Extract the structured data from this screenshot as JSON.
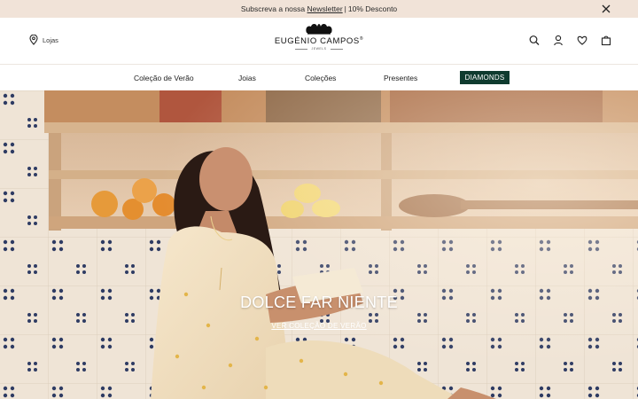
{
  "announcement": {
    "prefix": "Subscreva a nossa",
    "link": "Newsletter",
    "separator": "|",
    "suffix": "10% Desconto",
    "close_icon": "close-icon"
  },
  "header": {
    "stores_label": "Lojas",
    "stores_icon": "location-pin-icon",
    "logo": {
      "brand": "EUGÉNIO CAMPOS",
      "sub": "JEWELS"
    },
    "icons": [
      "search-icon",
      "account-icon",
      "heart-icon",
      "bag-icon"
    ]
  },
  "nav": {
    "items": [
      "Coleção de Verão",
      "Joias",
      "Coleções",
      "Presentes"
    ],
    "highlight": "DIAMONDS",
    "highlight_color": "#0f3b2f"
  },
  "hero": {
    "title": "DOLCE FAR NIENTE",
    "cta": "VER COLEÇÃO DE VERÃO"
  }
}
